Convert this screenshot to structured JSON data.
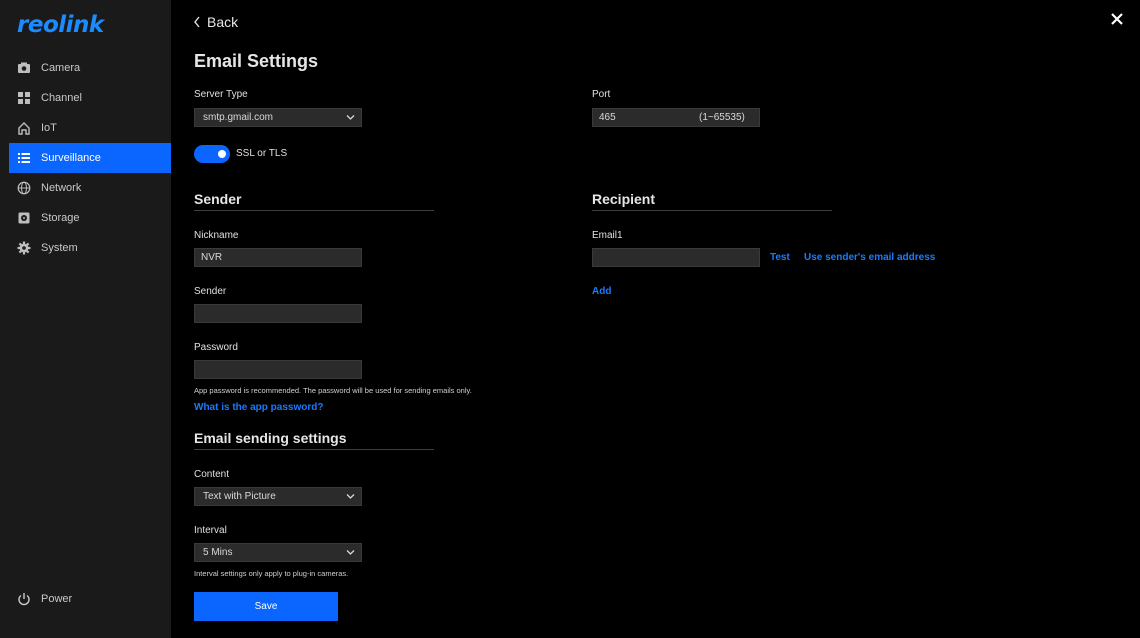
{
  "app": {
    "logo_text": "reolink",
    "brand_color": "#0a66ff"
  },
  "sidebar": {
    "items": [
      {
        "label": "Camera",
        "icon": "camera-icon"
      },
      {
        "label": "Channel",
        "icon": "grid-icon"
      },
      {
        "label": "IoT",
        "icon": "home-icon"
      },
      {
        "label": "Surveillance",
        "icon": "list-icon",
        "active": true
      },
      {
        "label": "Network",
        "icon": "globe-icon"
      },
      {
        "label": "Storage",
        "icon": "storage-icon"
      },
      {
        "label": "System",
        "icon": "gear-icon"
      }
    ],
    "power_label": "Power"
  },
  "header": {
    "back_label": "Back",
    "title": "Email Settings"
  },
  "server": {
    "server_type_label": "Server Type",
    "server_type_value": "smtp.gmail.com",
    "port_label": "Port",
    "port_value": "465",
    "port_range": "(1~65535)",
    "ssl_label": "SSL or TLS",
    "ssl_enabled": true
  },
  "sender": {
    "section_title": "Sender",
    "nickname_label": "Nickname",
    "nickname_value": "NVR",
    "sender_label": "Sender",
    "sender_value": "",
    "password_label": "Password",
    "password_value": "",
    "password_note": "App password is recommended. The password will be used for sending emails only.",
    "app_password_link": "What is the app password?"
  },
  "recipient": {
    "section_title": "Recipient",
    "email1_label": "Email1",
    "email1_value": "",
    "test_link": "Test",
    "use_sender_link": "Use sender's email address",
    "add_link": "Add"
  },
  "sending": {
    "section_title": "Email sending settings",
    "content_label": "Content",
    "content_value": "Text with Picture",
    "interval_label": "Interval",
    "interval_value": "5 Mins",
    "interval_note": "Interval settings only apply to plug-in cameras."
  },
  "save_label": "Save"
}
